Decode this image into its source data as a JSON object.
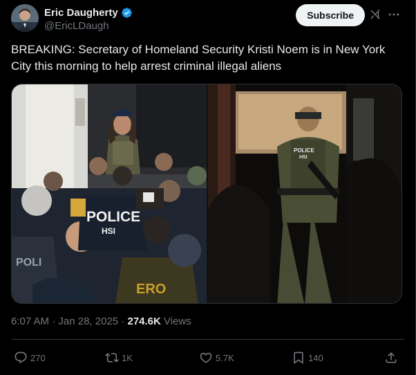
{
  "author": {
    "display_name": "Eric Daugherty",
    "handle": "@EricLDaugh",
    "verified": true
  },
  "header": {
    "subscribe_label": "Subscribe",
    "grok_icon": "grok-icon",
    "more_icon": "more-icon"
  },
  "tweet": {
    "text": "BREAKING: Secretary of Homeland Security Kristi Noem is in New York City this morning to help arrest criminal illegal aliens"
  },
  "media": {
    "left_image_labels": [
      "POLICE",
      "HSI",
      "ERO",
      "POLI"
    ],
    "right_image_labels": [
      "POLICE",
      "HSI"
    ]
  },
  "meta": {
    "time": "6:07 AM",
    "date": "Jan 28, 2025",
    "separator": "·",
    "views_count": "274.6K",
    "views_label": "Views"
  },
  "actions": {
    "replies": "270",
    "reposts": "1K",
    "likes": "5.7K",
    "bookmarks": "140"
  },
  "colors": {
    "background": "#000000",
    "text_primary": "#e7e9ea",
    "text_secondary": "#71767b",
    "verified_blue": "#1d9bf0",
    "subscribe_bg": "#eff3f4",
    "border": "#2f3336"
  }
}
